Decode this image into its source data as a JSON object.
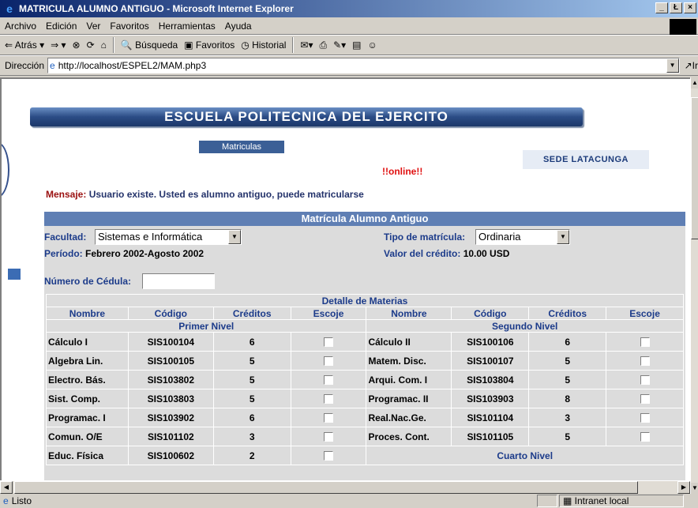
{
  "window": {
    "title": "MATRICULA ALUMNO ANTIGUO - Microsoft Internet Explorer",
    "buttons": [
      "_",
      "Ł",
      "×"
    ]
  },
  "menu": {
    "items": [
      "Archivo",
      "Edición",
      "Ver",
      "Favoritos",
      "Herramientas",
      "Ayuda"
    ]
  },
  "toolbar": {
    "back": "⇐ Atrás ▾",
    "forward": "⇒ ▾",
    "search": "Búsqueda",
    "favorites": "Favoritos",
    "history": "Historial"
  },
  "address": {
    "label": "Dirección",
    "url": "http://localhost/ESPEL2/MAM.php3",
    "go": "↗Ir"
  },
  "page": {
    "banner": "ESCUELA POLITECNICA DEL EJERCITO",
    "nav_button": "Matriculas",
    "sede": "SEDE LATACUNGA",
    "online": "!!online!!",
    "message_label": "Mensaje:",
    "message_text": " Usuario existe. Usted es alumno antiguo, puede matricularse"
  },
  "form": {
    "title": "Matrícula Alumno Antiguo",
    "facultad_label": "Facultad:",
    "facultad_value": "Sistemas e Informática",
    "tipo_label": "Tipo de matrícula:",
    "tipo_value": "Ordinaria",
    "periodo_label": "Período:",
    "periodo_value": " Febrero 2002-Agosto 2002",
    "valor_label": "Valor del crédito:",
    "valor_value": " 10.00 USD",
    "cedula_label": "Número de Cédula:",
    "cedula_value": ""
  },
  "detail": {
    "title": "Detalle de Materias",
    "headers": [
      "Nombre",
      "Código",
      "Créditos",
      "Escoje",
      "Nombre",
      "Código",
      "Créditos",
      "Escoje"
    ],
    "left_level": "Primer Nivel",
    "right_level": "Segundo Nivel",
    "right_level2": "Cuarto Nivel",
    "rows": [
      {
        "l_name": "Cálculo I",
        "l_code": "SIS100104",
        "l_cr": "6",
        "r_name": "Cálculo II",
        "r_code": "SIS100106",
        "r_cr": "6"
      },
      {
        "l_name": "Algebra Lin.",
        "l_code": "SIS100105",
        "l_cr": "5",
        "r_name": "Matem. Disc.",
        "r_code": "SIS100107",
        "r_cr": "5"
      },
      {
        "l_name": "Electro. Bás.",
        "l_code": "SIS103802",
        "l_cr": "5",
        "r_name": "Arqui. Com. I",
        "r_code": "SIS103804",
        "r_cr": "5"
      },
      {
        "l_name": "Sist. Comp.",
        "l_code": "SIS103803",
        "l_cr": "5",
        "r_name": "Programac. II",
        "r_code": "SIS103903",
        "r_cr": "8"
      },
      {
        "l_name": "Programac. I",
        "l_code": "SIS103902",
        "l_cr": "6",
        "r_name": "Real.Nac.Ge.",
        "r_code": "SIS101104",
        "r_cr": "3"
      },
      {
        "l_name": "Comun. O/E",
        "l_code": "SIS101102",
        "l_cr": "3",
        "r_name": "Proces. Cont.",
        "r_code": "SIS101105",
        "r_cr": "5"
      }
    ],
    "last_row": {
      "l_name": "Educ. Física",
      "l_code": "SIS100602",
      "l_cr": "2"
    }
  },
  "status": {
    "text": "Listo",
    "zone": "Intranet local"
  }
}
